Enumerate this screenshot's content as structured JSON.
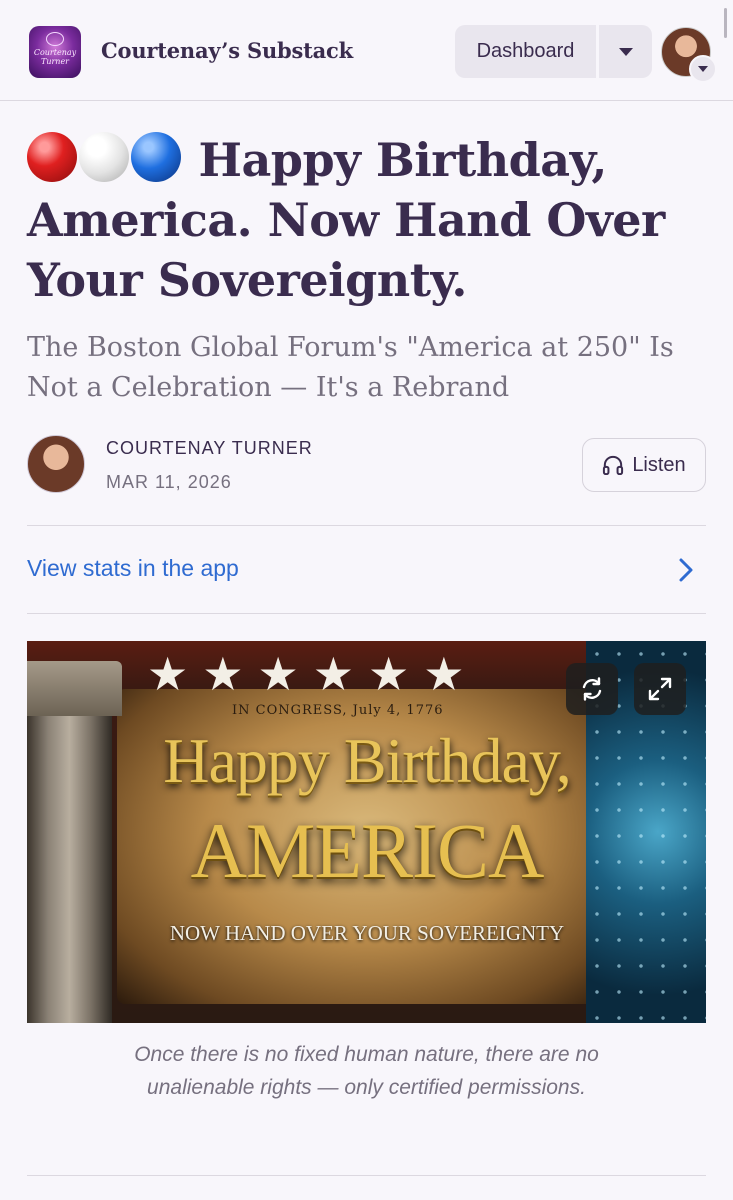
{
  "header": {
    "publication_name": "Courtenay’s Substack",
    "logo_text": "Courtenay Turner",
    "dashboard_label": "Dashboard"
  },
  "post": {
    "title": "Happy Birthday, America. Now Hand Over Your Sovereignty.",
    "title_emoji": [
      "red-circle",
      "white-circle",
      "blue-circle"
    ],
    "subtitle": "The Boston Global Forum's \"America at 250\" Is Not a Celebration — It's a Rebrand",
    "author": "COURTENAY TURNER",
    "date": "MAR 11, 2026",
    "listen_label": "Listen",
    "stats_link": "View stats in the app"
  },
  "hero_image": {
    "stars": "★★★★★★",
    "congress_text": "IN CONGRESS, July 4, 1776",
    "line1": "Happy Birthday,",
    "line2": "AMERICA",
    "line3": "NOW HAND OVER YOUR SOVEREIGNTY",
    "icons": [
      "refresh-icon",
      "expand-icon"
    ]
  },
  "caption": "Once there is no fixed human nature, there are no unalienable rights — only certified permissions.",
  "colors": {
    "background": "#f8f6fb",
    "title_text": "#3a2c4e",
    "muted_text": "#76707f",
    "link_blue": "#2f6bd1"
  }
}
